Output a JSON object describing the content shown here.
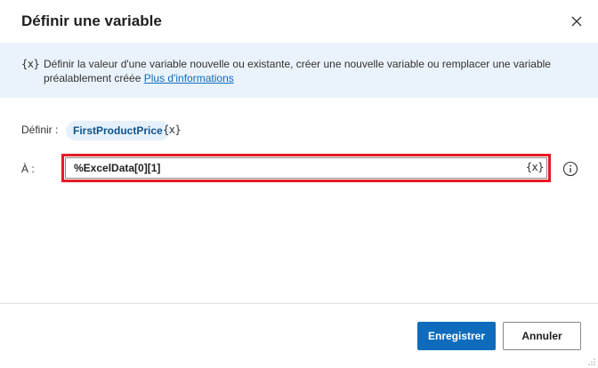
{
  "dialog": {
    "title": "Définir une variable",
    "close_icon": "close-icon"
  },
  "banner": {
    "icon_text": "{x}",
    "description": "Définir la valeur d'une variable nouvelle ou existante, créer une nouvelle variable ou remplacer une variable préalablement créée ",
    "link_text": "Plus d'informations"
  },
  "form": {
    "set_label": "Définir :",
    "variable_name": "FirstProductPrice",
    "variable_picker": "{x}",
    "to_label": "À :",
    "value": "%ExcelData[0][1]",
    "value_picker": "{x}",
    "info_icon": "info-icon"
  },
  "footer": {
    "save_label": "Enregistrer",
    "cancel_label": "Annuler"
  },
  "colors": {
    "accent": "#0f6cbd",
    "banner_bg": "#eaf3fc",
    "highlight": "#e31b23"
  }
}
